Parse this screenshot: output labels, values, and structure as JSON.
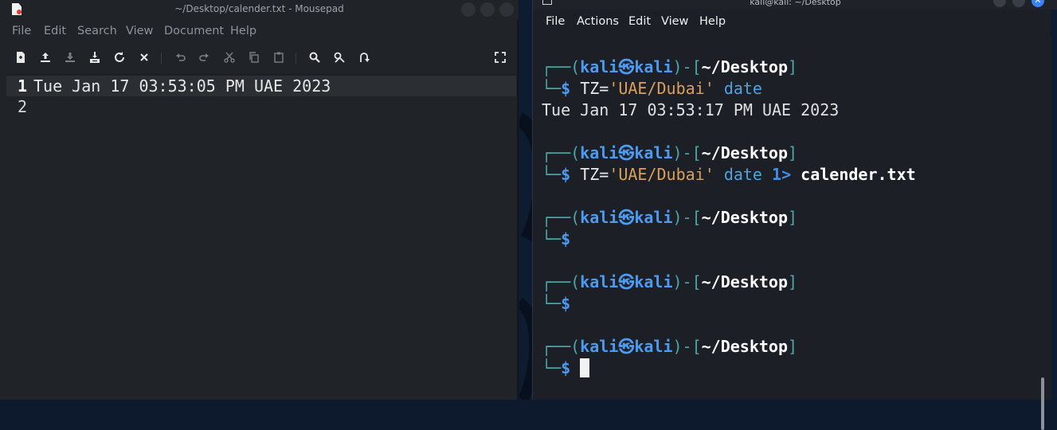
{
  "mousepad": {
    "title": "~/Desktop/calender.txt - Mousepad",
    "menu": [
      "File",
      "Edit",
      "Search",
      "View",
      "Document",
      "Help"
    ],
    "toolbar_icons": [
      "new-file-icon",
      "open-file-icon",
      "save-file-icon",
      "save-as-icon",
      "reload-icon",
      "close-file-icon",
      "undo-icon",
      "redo-icon",
      "cut-icon",
      "copy-icon",
      "paste-icon",
      "find-icon",
      "find-replace-icon",
      "goto-line-icon",
      "fullscreen-icon"
    ],
    "lines": [
      {
        "num": "1",
        "text": "Tue Jan 17 03:53:05 PM UAE 2023"
      },
      {
        "num": "2",
        "text": ""
      }
    ]
  },
  "terminal": {
    "title": "kali@kali: ~/Desktop",
    "menu": [
      "File",
      "Actions",
      "Edit",
      "View",
      "Help"
    ],
    "prompt": {
      "open": "┌──(",
      "user": "kali",
      "at": "㉿",
      "host": "kali",
      "close": ")-[",
      "path": "~/Desktop",
      "end": "]",
      "corner": "└─",
      "dollar": "$"
    },
    "commands": [
      {
        "tz": "TZ=",
        "zone": "'UAE/Dubai'",
        "cmd": "date",
        "redir": "",
        "file": "",
        "output": "Tue Jan 17 03:53:17 PM UAE 2023"
      },
      {
        "tz": "TZ=",
        "zone": "'UAE/Dubai'",
        "cmd": "date",
        "redir": "1>",
        "file": "calender.txt",
        "output": ""
      }
    ]
  },
  "colors": {
    "accent_blue": "#4d9bf0",
    "prompt_teal": "#4aa8a8",
    "string_orange": "#d9a05b",
    "editor_bg": "#202328",
    "terminal_bg": "#1c1f26"
  }
}
